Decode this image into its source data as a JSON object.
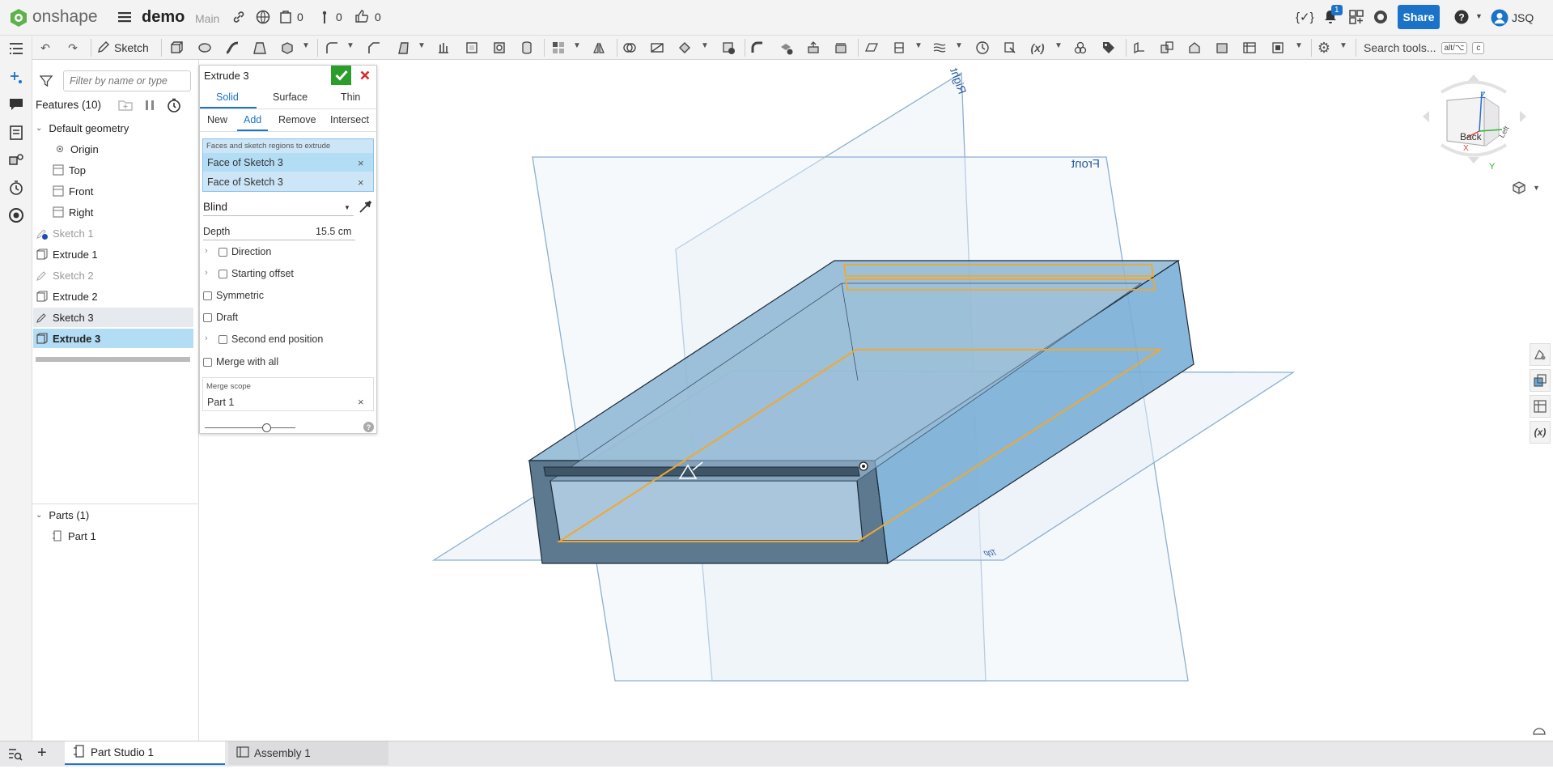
{
  "app": {
    "logo_text": "onshape",
    "doc_name": "demo",
    "branch": "Main",
    "counts": {
      "versions": "0",
      "branches": "0",
      "likes": "0"
    },
    "notifications": "1",
    "share_label": "Share",
    "user_initials": "JSQ",
    "code_icon_label": "{✓}"
  },
  "toolbar": {
    "sketch_label": "Sketch",
    "search_label": "Search tools...",
    "search_shortcut_1": "alt/⌥",
    "search_shortcut_2": "c"
  },
  "feature_panel": {
    "filter_placeholder": "Filter by name or type",
    "features_header": "Features (10)",
    "default_geometry": "Default geometry",
    "items": [
      {
        "label": "Origin"
      },
      {
        "label": "Top"
      },
      {
        "label": "Front"
      },
      {
        "label": "Right"
      },
      {
        "label": "Sketch 1"
      },
      {
        "label": "Extrude 1"
      },
      {
        "label": "Sketch 2"
      },
      {
        "label": "Extrude 2"
      },
      {
        "label": "Sketch 3"
      },
      {
        "label": "Extrude 3"
      }
    ],
    "parts_header": "Parts (1)",
    "parts": [
      {
        "label": "Part 1"
      }
    ]
  },
  "dialog": {
    "title": "Extrude 3",
    "type_tabs": [
      "Solid",
      "Surface",
      "Thin"
    ],
    "op_tabs": [
      "New",
      "Add",
      "Remove",
      "Intersect"
    ],
    "faces_label": "Faces and sketch regions to extrude",
    "faces": [
      "Face of Sketch 3",
      "Face of Sketch 3"
    ],
    "end_type": "Blind",
    "depth_label": "Depth",
    "depth_value": "15.5 cm",
    "direction_label": "Direction",
    "starting_offset_label": "Starting offset",
    "symmetric_label": "Symmetric",
    "draft_label": "Draft",
    "second_end_label": "Second end position",
    "merge_all_label": "Merge with all",
    "merge_scope_label": "Merge scope",
    "merge_scope_value": "Part 1",
    "help": "?"
  },
  "viewport": {
    "plane_labels": {
      "right": "Right",
      "front": "Front",
      "top": "Top"
    },
    "viewcube": {
      "back": "Back",
      "left": "Left",
      "z": "Z",
      "y": "Y",
      "x": "X"
    }
  },
  "tabs": [
    {
      "label": "Part Studio 1"
    },
    {
      "label": "Assembly 1"
    }
  ],
  "colors": {
    "accent": "#1a73c8",
    "selection": "#b3dcf5",
    "sketch_orange": "#f0a830",
    "part_blue": "#7ab0d4",
    "confirm_green": "#2a9d2a",
    "cancel_red": "#d62a2a"
  }
}
